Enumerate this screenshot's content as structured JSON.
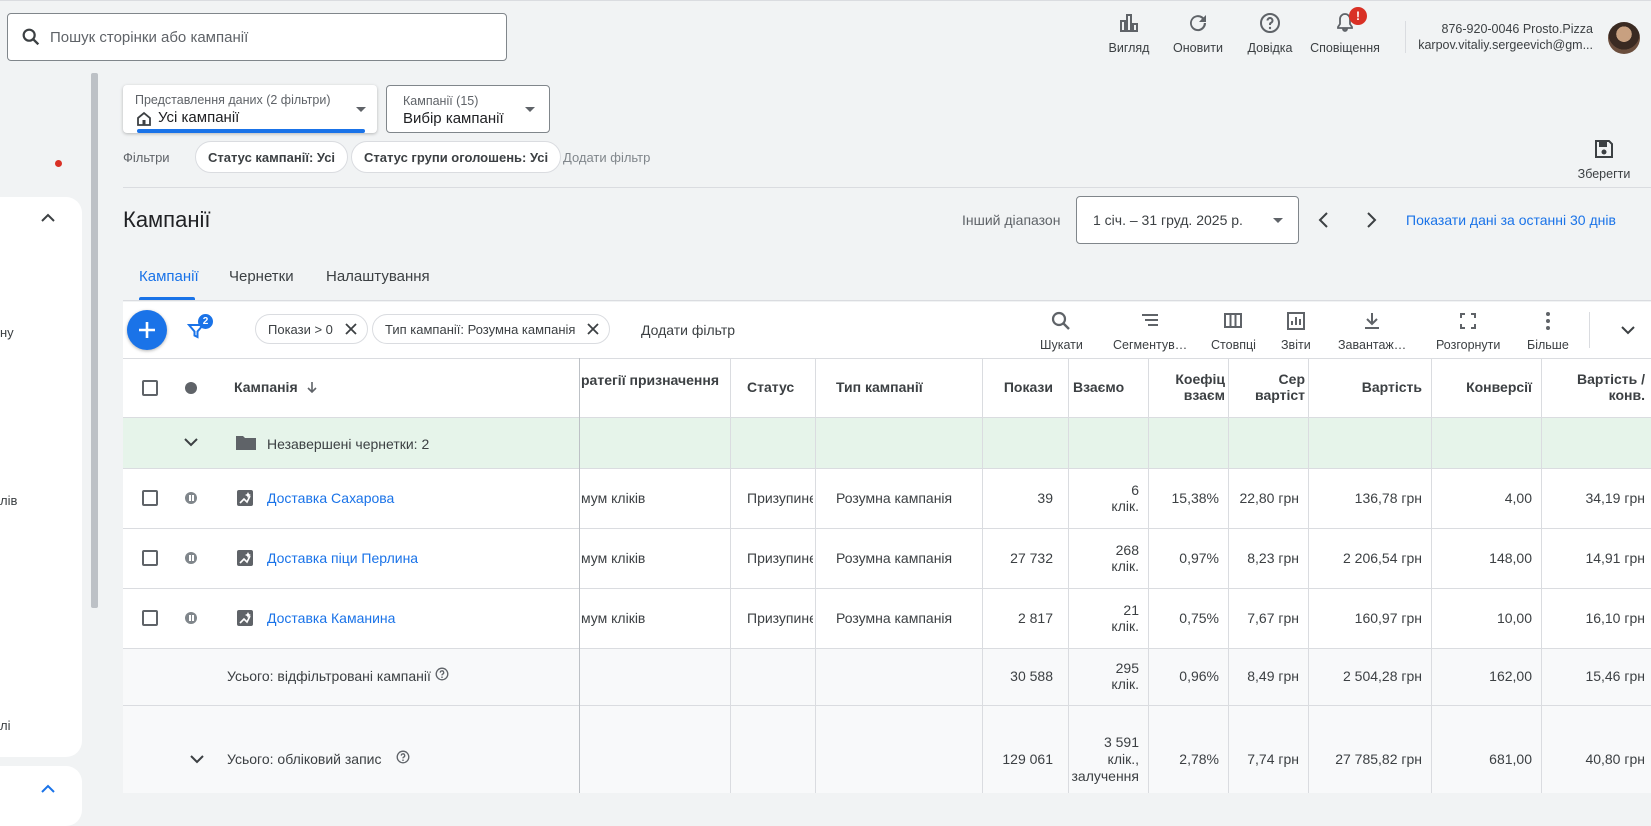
{
  "header": {
    "search_placeholder": "Пошук сторінки або кампанії",
    "buttons": [
      {
        "label": "Вигляд",
        "icon": "view-icon"
      },
      {
        "label": "Оновити",
        "icon": "refresh-icon"
      },
      {
        "label": "Довідка",
        "icon": "help-icon"
      },
      {
        "label": "Сповіщення",
        "icon": "bell-icon",
        "badge": "!"
      }
    ],
    "account": {
      "line1": "876-920-0046 Prosto.Pizza",
      "line2": "karpov.vitaliy.sergeevich@gm..."
    }
  },
  "sidebar": {
    "fragments": [
      "ну",
      "лів",
      "лі"
    ]
  },
  "filters": {
    "view": {
      "label": "Представлення даних (2 фільтри)",
      "value": "Усі кампанії"
    },
    "campaigns": {
      "label": "Кампанії (15)",
      "value": "Вибір кампанії"
    },
    "filters_label": "Фільтри",
    "chips": [
      "Статус кампанії: Усі",
      "Статус групи оголошень: Усі"
    ],
    "add_filter": "Додати фільтр",
    "save_label": "Зберегти"
  },
  "page": {
    "title": "Кампанії",
    "date_range_label": "Інший діапазон",
    "date_range": "1 січ. – 31 груд. 2025 р.",
    "show_30_days": "Показати дані за останні 30 днів",
    "tabs": [
      "Кампанії",
      "Чернетки",
      "Налаштування"
    ]
  },
  "toolbar": {
    "filter_count": "2",
    "chips": [
      "Покази > 0",
      "Тип кампанії: Розумна кампанія"
    ],
    "add_filter": "Додати фільтр",
    "actions": [
      {
        "label": "Шукати",
        "icon": "search-icon"
      },
      {
        "label": "Сегментув…",
        "icon": "segment-icon"
      },
      {
        "label": "Стовпці",
        "icon": "columns-icon"
      },
      {
        "label": "Звіти",
        "icon": "reports-icon"
      },
      {
        "label": "Завантаж…",
        "icon": "download-icon"
      },
      {
        "label": "Розгорнути",
        "icon": "expand-icon"
      },
      {
        "label": "Більше",
        "icon": "more-icon"
      }
    ]
  },
  "table": {
    "headers": {
      "campaign": "Кампанія",
      "strategy": "ратегії призначення",
      "status": "Статус",
      "type": "Тип кампанії",
      "impr": "Покази",
      "interactions": "Взаємо",
      "rate_1": "Коефіц",
      "rate_2": "взаєм",
      "avg_1": "Сер",
      "avg_2": "вартіст",
      "cost": "Вартість",
      "conv": "Конверсії",
      "cpc_1": "Вартість /",
      "cpc_2": "конв."
    },
    "drafts_row": "Незавершені чернетки: 2",
    "rows": [
      {
        "name": "Доставка Сахарова",
        "strategy": "мум кліків",
        "status": "Призупине",
        "type": "Розумна кампанія",
        "impr": "39",
        "int_1": "6",
        "int_2": "клік.",
        "rate": "15,38%",
        "avg": "22,80 грн",
        "cost": "136,78 грн",
        "conv": "4,00",
        "cpa": "34,19 грн"
      },
      {
        "name": "Доставка піци Перлина",
        "strategy": "мум кліків",
        "status": "Призупине",
        "type": "Розумна кампанія",
        "impr": "27 732",
        "int_1": "268",
        "int_2": "клік.",
        "rate": "0,97%",
        "avg": "8,23 грн",
        "cost": "2 206,54 грн",
        "conv": "148,00",
        "cpa": "14,91 грн"
      },
      {
        "name": "Доставка Каманина",
        "strategy": "мум кліків",
        "status": "Призупине",
        "type": "Розумна кампанія",
        "impr": "2 817",
        "int_1": "21",
        "int_2": "клік.",
        "rate": "0,75%",
        "avg": "7,67 грн",
        "cost": "160,97 грн",
        "conv": "10,00",
        "cpa": "16,10 грн"
      }
    ],
    "total_filtered": {
      "label": "Усього: відфільтровані кампанії",
      "impr": "30 588",
      "int_1": "295",
      "int_2": "клік.",
      "rate": "0,96%",
      "avg": "8,49 грн",
      "cost": "2 504,28 грн",
      "conv": "162,00",
      "cpa": "15,46 грн"
    },
    "total_account": {
      "label": "Усього: обліковий запис",
      "impr": "129 061",
      "int_1": "3 591",
      "int_2": "клік.,",
      "int_3": "залучення",
      "rate": "2,78%",
      "avg": "7,74 грн",
      "cost": "27 785,82 грн",
      "conv": "681,00",
      "cpa": "40,80 грн"
    }
  }
}
